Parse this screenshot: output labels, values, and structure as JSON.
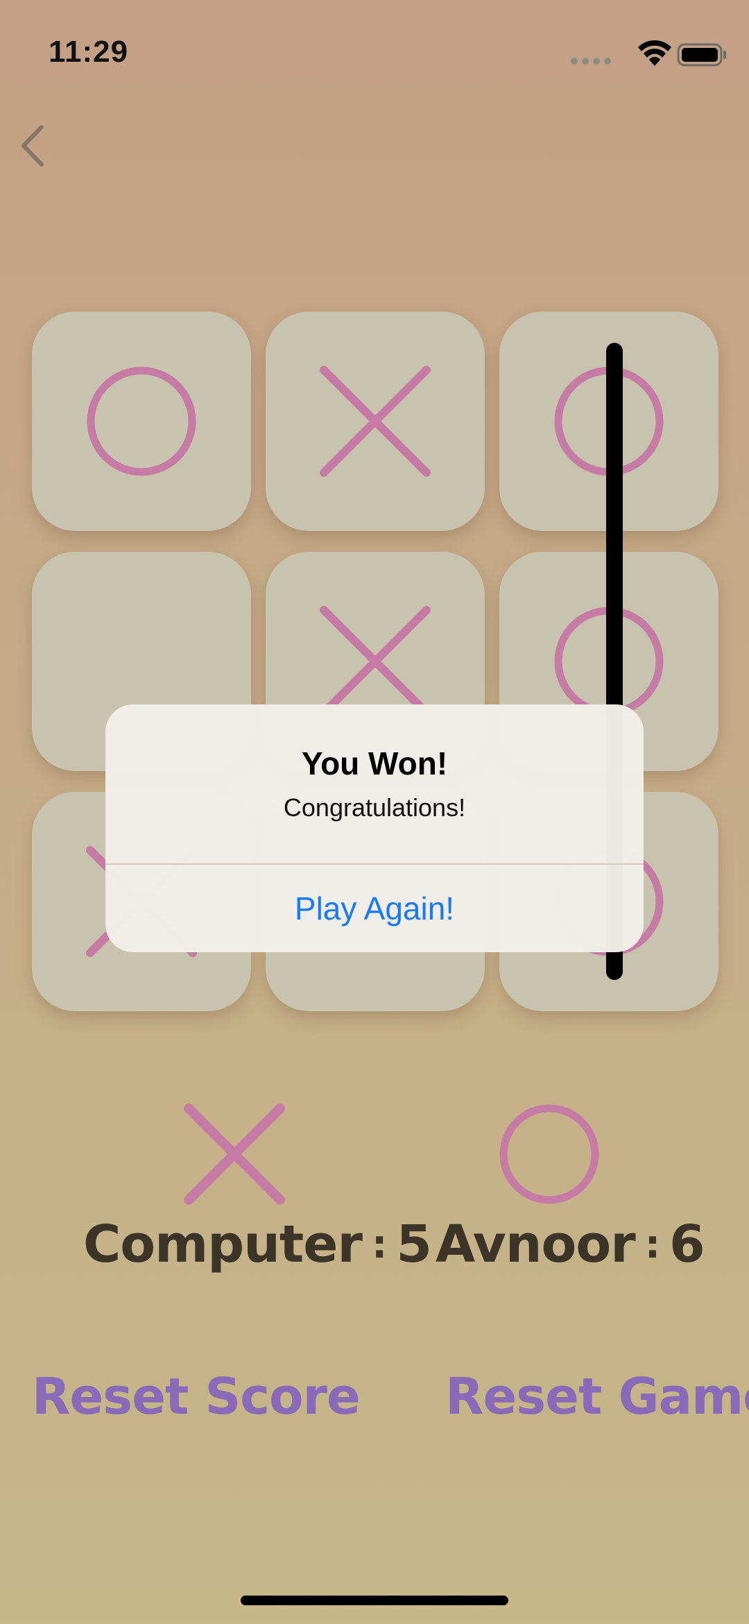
{
  "status_bar": {
    "time": "11:29",
    "icons": [
      "signal-dots-icon",
      "wifi-icon",
      "battery-icon"
    ]
  },
  "nav": {
    "back_icon": "chevron-left-icon"
  },
  "board": {
    "cells": [
      "O",
      "X",
      "O",
      "",
      "X",
      "O",
      "X",
      "",
      "O"
    ],
    "winning_line": "column-3",
    "mark_color": "#c57ba4",
    "cell_color": "#c8c3af"
  },
  "alert": {
    "title": "You Won!",
    "message": "Congratulations!",
    "action_label": "Play Again!",
    "action_color": "#1a7bf0"
  },
  "scoreboard": {
    "computer": {
      "symbol": "X",
      "name": "Computer",
      "separator": ":",
      "score": "5"
    },
    "player": {
      "symbol": "O",
      "name": "Avnoor",
      "separator": ":",
      "score": "6"
    }
  },
  "actions": {
    "reset_score_label": "Reset Score",
    "reset_game_label": "Reset Game",
    "color": "#8a6ab8"
  }
}
